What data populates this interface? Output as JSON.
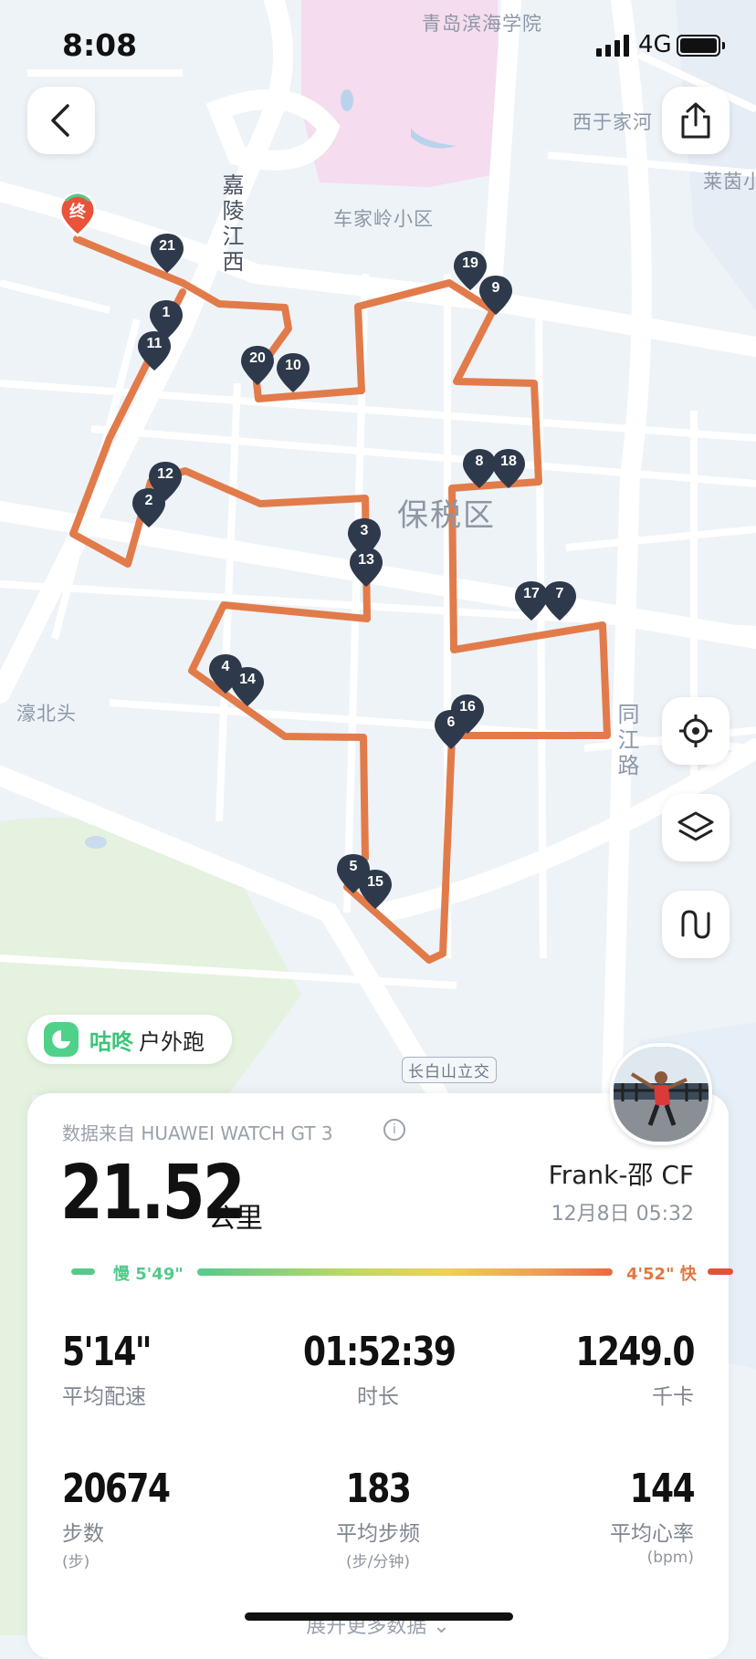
{
  "status_bar": {
    "time": "8:08",
    "network": "4G"
  },
  "map": {
    "labels": {
      "college": "青岛滨海学院",
      "xiyu": "西于家河",
      "laiyin": "莱茵小",
      "chejialing": "车家岭小区",
      "jialingjiang": "嘉陵江西",
      "baoshui": "保税区",
      "haobeitou": "濠北头",
      "tongjiang": "同江路",
      "changbaishan": "长白山立交"
    },
    "end_marker": "终",
    "markers": [
      "21",
      "1",
      "11",
      "20",
      "10",
      "19",
      "9",
      "8",
      "18",
      "12",
      "2",
      "3",
      "13",
      "17",
      "7",
      "4",
      "14",
      "6",
      "16",
      "5",
      "15"
    ]
  },
  "activity": {
    "brand": "咕咚",
    "type": "户外跑"
  },
  "card": {
    "source": "数据来自 HUAWEI WATCH GT 3",
    "info_icon": "i",
    "distance": "21.52",
    "distance_unit": "公里",
    "user": "Frank-邵 CF",
    "datetime": "12月8日 05:32",
    "pace_slow": "慢 5'49\"",
    "pace_fast": "4'52\" 快",
    "stats": [
      {
        "value": "5'14\"",
        "label": "平均配速",
        "sub": ""
      },
      {
        "value": "01:52:39",
        "label": "时长",
        "sub": ""
      },
      {
        "value": "1249.0",
        "label": "千卡",
        "sub": ""
      },
      {
        "value": "20674",
        "label": "步数",
        "sub": "(步)"
      },
      {
        "value": "183",
        "label": "平均步频",
        "sub": "(步/分钟)"
      },
      {
        "value": "144",
        "label": "平均心率",
        "sub": "(bpm)"
      }
    ],
    "more": "展开更多数据"
  },
  "colors": {
    "route": "#e27b4a",
    "marker": "#2e3a4b",
    "end": "#e8533a",
    "brand": "#3cc47a"
  }
}
